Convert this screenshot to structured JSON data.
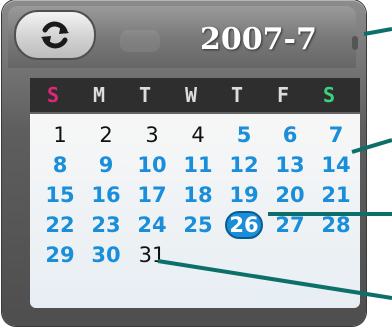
{
  "calendar": {
    "year_month": "2007-7",
    "weekdays": [
      "S",
      "M",
      "T",
      "W",
      "T",
      "F",
      "S"
    ],
    "weekday_colors": [
      "#e0267a",
      "#dddddd",
      "#dddddd",
      "#dddddd",
      "#dddddd",
      "#dddddd",
      "#3ed07a"
    ],
    "today": "26",
    "rows": [
      [
        "1",
        "2",
        "3",
        "4",
        "5",
        "6",
        "7"
      ],
      [
        "8",
        "9",
        "10",
        "11",
        "12",
        "13",
        "14"
      ],
      [
        "15",
        "16",
        "17",
        "18",
        "19",
        "20",
        "21"
      ],
      [
        "22",
        "23",
        "24",
        "25",
        "26",
        "27",
        "28"
      ],
      [
        "29",
        "30",
        "31",
        "",
        "",
        "",
        ""
      ]
    ],
    "black_days": [
      "1",
      "2",
      "3",
      "4",
      "31"
    ]
  },
  "header": {
    "refresh_icon": "refresh-icon"
  },
  "colors": {
    "accent": "#1a8ed8",
    "pointer": "#0d6f6a"
  }
}
